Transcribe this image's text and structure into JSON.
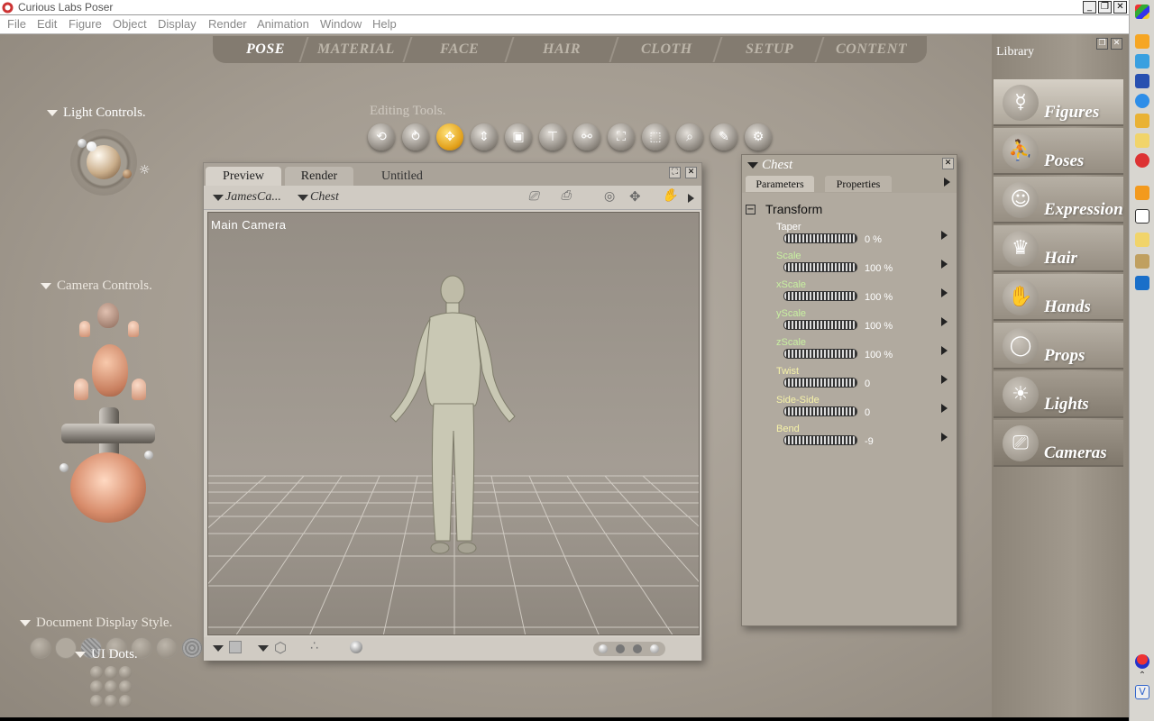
{
  "window": {
    "title": "Curious Labs Poser"
  },
  "menu": [
    "File",
    "Edit",
    "Figure",
    "Object",
    "Display",
    "Render",
    "Animation",
    "Window",
    "Help"
  ],
  "rooms": [
    "POSE",
    "MATERIAL",
    "FACE",
    "HAIR",
    "CLOTH",
    "SETUP",
    "CONTENT"
  ],
  "light_controls": {
    "label": "Light Controls."
  },
  "camera_controls": {
    "label": "Camera Controls."
  },
  "editing_tools": {
    "label": "Editing Tools."
  },
  "document_display": {
    "label": "Document Display Style."
  },
  "ui_dots": {
    "label": "UI Dots."
  },
  "document": {
    "tabs": [
      "Preview",
      "Render"
    ],
    "title": "Untitled",
    "figure_menu": "JamesCa...",
    "actor_menu": "Chest",
    "camera_label": "Main Camera"
  },
  "parameters": {
    "title": "Chest",
    "tabs": [
      "Parameters",
      "Properties"
    ],
    "group": "Transform",
    "group_toggle": "−",
    "items": [
      {
        "label": "Taper",
        "value": "0 %",
        "color": "#ffffff"
      },
      {
        "label": "Scale",
        "value": "100 %",
        "color": "#c8f0a0"
      },
      {
        "label": "xScale",
        "value": "100 %",
        "color": "#c8f0a0"
      },
      {
        "label": "yScale",
        "value": "100 %",
        "color": "#c8f0a0"
      },
      {
        "label": "zScale",
        "value": "100 %",
        "color": "#c8f0a0"
      },
      {
        "label": "Twist",
        "value": "0",
        "color": "#f6f2a8"
      },
      {
        "label": "Side-Side",
        "value": "0",
        "color": "#f6f2a8"
      },
      {
        "label": "Bend",
        "value": "-9",
        "color": "#f6f2a8"
      }
    ]
  },
  "library": {
    "title": "Library",
    "items": [
      "Figures",
      "Poses",
      "Expression",
      "Hair",
      "Hands",
      "Props",
      "Lights",
      "Cameras"
    ]
  }
}
